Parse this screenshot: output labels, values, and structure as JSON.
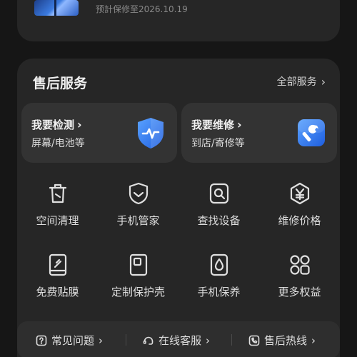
{
  "device": {
    "warranty_text": "预計保修至2026.10.19"
  },
  "after_sales": {
    "title": "售后服务",
    "all_services_label": "全部服务",
    "cards": [
      {
        "title": "我要检测",
        "subtitle": "屏幕/电池等",
        "icon": "shield-pulse-icon"
      },
      {
        "title": "我要维修",
        "subtitle": "到店/寄修等",
        "icon": "wrench-icon"
      }
    ],
    "grid": [
      {
        "label": "空间清理",
        "icon": "trash-icon"
      },
      {
        "label": "手机管家",
        "icon": "shield-check-icon"
      },
      {
        "label": "查找设备",
        "icon": "find-device-icon"
      },
      {
        "label": "维修价格",
        "icon": "yuan-icon"
      },
      {
        "label": "免费贴膜",
        "icon": "screen-film-icon"
      },
      {
        "label": "定制保护壳",
        "icon": "phone-case-icon"
      },
      {
        "label": "手机保养",
        "icon": "drop-icon"
      },
      {
        "label": "更多权益",
        "icon": "grid-more-icon"
      }
    ],
    "bottom_links": [
      {
        "label": "常见问题",
        "icon": "question-icon"
      },
      {
        "label": "在线客服",
        "icon": "headset-icon"
      },
      {
        "label": "售后热线",
        "icon": "phone-call-icon"
      }
    ]
  },
  "colors": {
    "background": "#161616",
    "card": "#262626",
    "accent_blue": "#2f7cf6"
  }
}
